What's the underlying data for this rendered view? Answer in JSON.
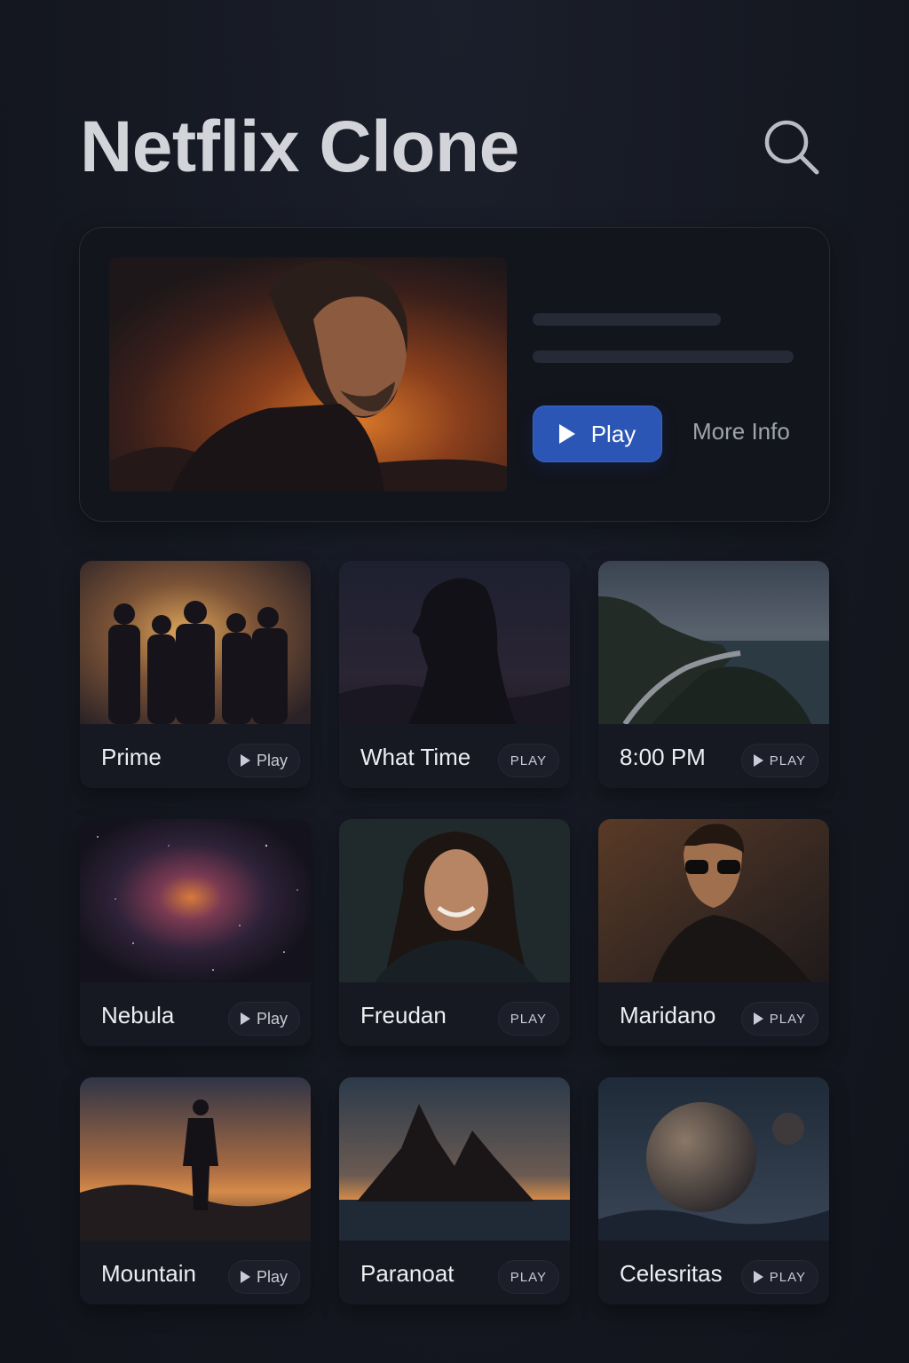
{
  "header": {
    "title": "Netflix Clone",
    "search_icon": "search-icon"
  },
  "hero": {
    "play_label": "Play",
    "more_info_label": "More Info",
    "accent_color": "#2c56b5"
  },
  "grid": {
    "items": [
      {
        "title": "Prime",
        "button_label": "Play",
        "button_icon": "play-icon"
      },
      {
        "title": "What Time",
        "button_label": "PLAY",
        "button_icon": ""
      },
      {
        "title": "8:00 PM",
        "button_label": "PLAY",
        "button_icon": "play-icon"
      },
      {
        "title": "Nebula",
        "button_label": "Play",
        "button_icon": "play-icon"
      },
      {
        "title": "Freudan",
        "button_label": "PLAY",
        "button_icon": ""
      },
      {
        "title": "Maridano",
        "button_label": "PLAY",
        "button_icon": "play-icon"
      },
      {
        "title": "Mountain",
        "button_label": "Play",
        "button_icon": "play-icon"
      },
      {
        "title": "Paranoat",
        "button_label": "PLAY",
        "button_icon": ""
      },
      {
        "title": "Celesritas",
        "button_label": "PLAY",
        "button_icon": "play-icon"
      }
    ]
  }
}
